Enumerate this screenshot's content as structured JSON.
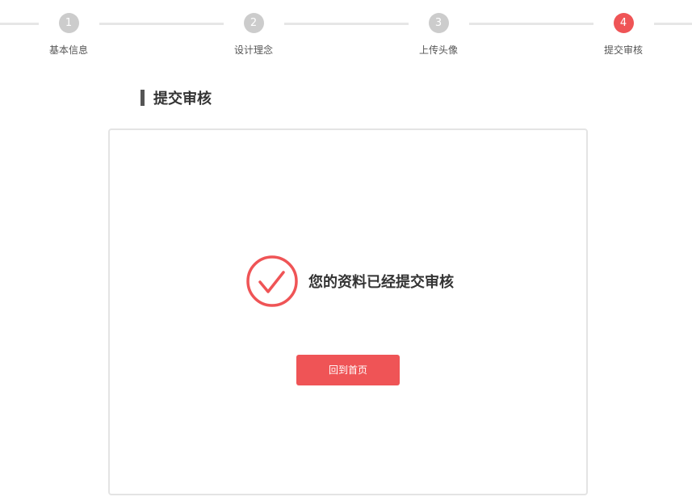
{
  "stepper": {
    "steps": [
      {
        "number": "1",
        "label": "基本信息",
        "state": "inactive"
      },
      {
        "number": "2",
        "label": "设计理念",
        "state": "inactive"
      },
      {
        "number": "3",
        "label": "上传头像",
        "state": "inactive"
      },
      {
        "number": "4",
        "label": "提交审核",
        "state": "active"
      }
    ]
  },
  "section": {
    "title": "提交审核"
  },
  "card": {
    "message": "您的资料已经提交审核",
    "icon": "check-circle-icon",
    "button_label": "回到首页"
  },
  "colors": {
    "accent": "#ef5456",
    "inactive_step": "#cccccc",
    "line": "#e6e6e6",
    "text": "#333333"
  }
}
